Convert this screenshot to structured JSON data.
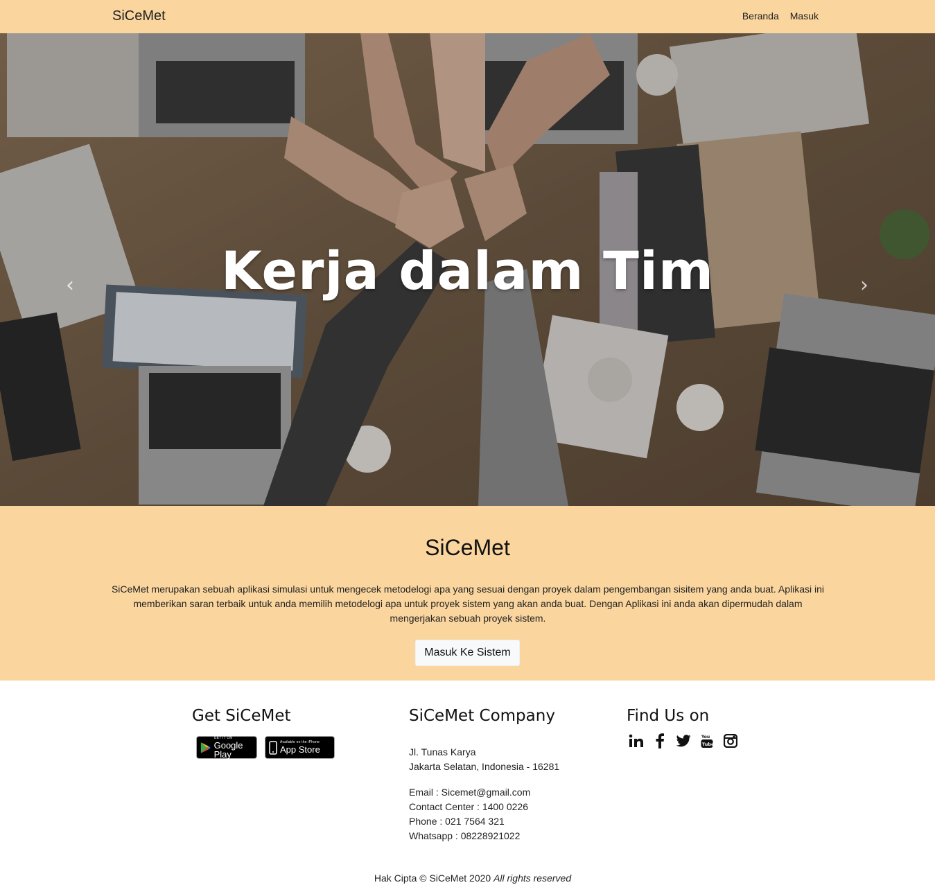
{
  "navbar": {
    "brand": "SiCeMet",
    "links": [
      "Beranda",
      "Masuk"
    ]
  },
  "hero": {
    "caption": "Kerja dalam Tim",
    "prev_icon": "chevron-left-icon",
    "next_icon": "chevron-right-icon"
  },
  "about": {
    "title": "SiCeMet",
    "description": "SiCeMet merupakan sebuah aplikasi simulasi untuk mengecek metodelogi apa yang sesuai dengan proyek dalam pengembangan sisitem yang anda buat. Aplikasi ini memberikan saran terbaik untuk anda memilih metodelogi apa untuk proyek sistem yang akan anda buat. Dengan Aplikasi ini anda akan dipermudah dalam mengerjakan sebuah proyek sistem.",
    "button": "Masuk Ke Sistem"
  },
  "footer": {
    "get_title": "Get SiCeMet",
    "google_play": {
      "small": "GET IT ON",
      "big": "Google Play"
    },
    "app_store": {
      "small": "Available on the iPhone",
      "big": "App Store"
    },
    "company_title": "SiCeMet Company",
    "address_line1": "Jl. Tunas Karya",
    "address_line2": "Jakarta Selatan, Indonesia - 16281",
    "email": "Email : Sicemet@gmail.com",
    "contact_center": "Contact Center : 1400 0226",
    "phone": "Phone : 021 7564 321",
    "whatsapp": "Whatsapp : 08228921022",
    "find_title": "Find Us on",
    "social": [
      "linkedin-icon",
      "facebook-icon",
      "twitter-icon",
      "youtube-icon",
      "instagram-icon"
    ],
    "copyright_main": "Hak Cipta © SiCeMet 2020",
    "copyright_em": "All rights reserved"
  }
}
